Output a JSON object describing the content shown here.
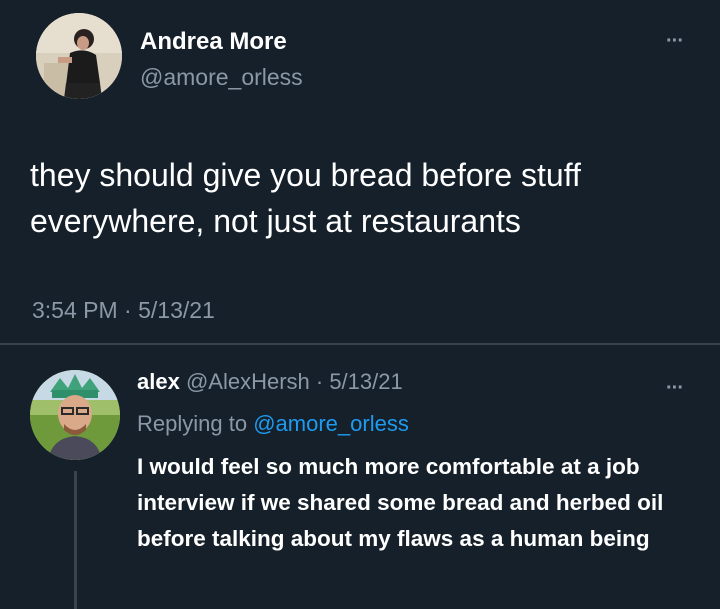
{
  "tweet": {
    "author_name": "Andrea More",
    "author_handle": "@amore_orless",
    "more_label": "···",
    "text": "they should give you bread before stuff everywhere, not just at restaurants",
    "timestamp": "3:54 PM · 5/13/21"
  },
  "reply": {
    "author_name": "alex",
    "meta": "@AlexHersh · 5/13/21",
    "more_label": "···",
    "replying_prefix": "Replying to",
    "replying_handle": "@amore_orless",
    "text": "I would feel so much more comfortable at a job interview if we shared some bread and herbed oil before talking about my flaws as a human being"
  },
  "colors": {
    "background": "#15202b",
    "text_primary": "#ffffff",
    "text_secondary": "#8b98a5",
    "link": "#1d9bf0",
    "divider": "#38444d"
  }
}
